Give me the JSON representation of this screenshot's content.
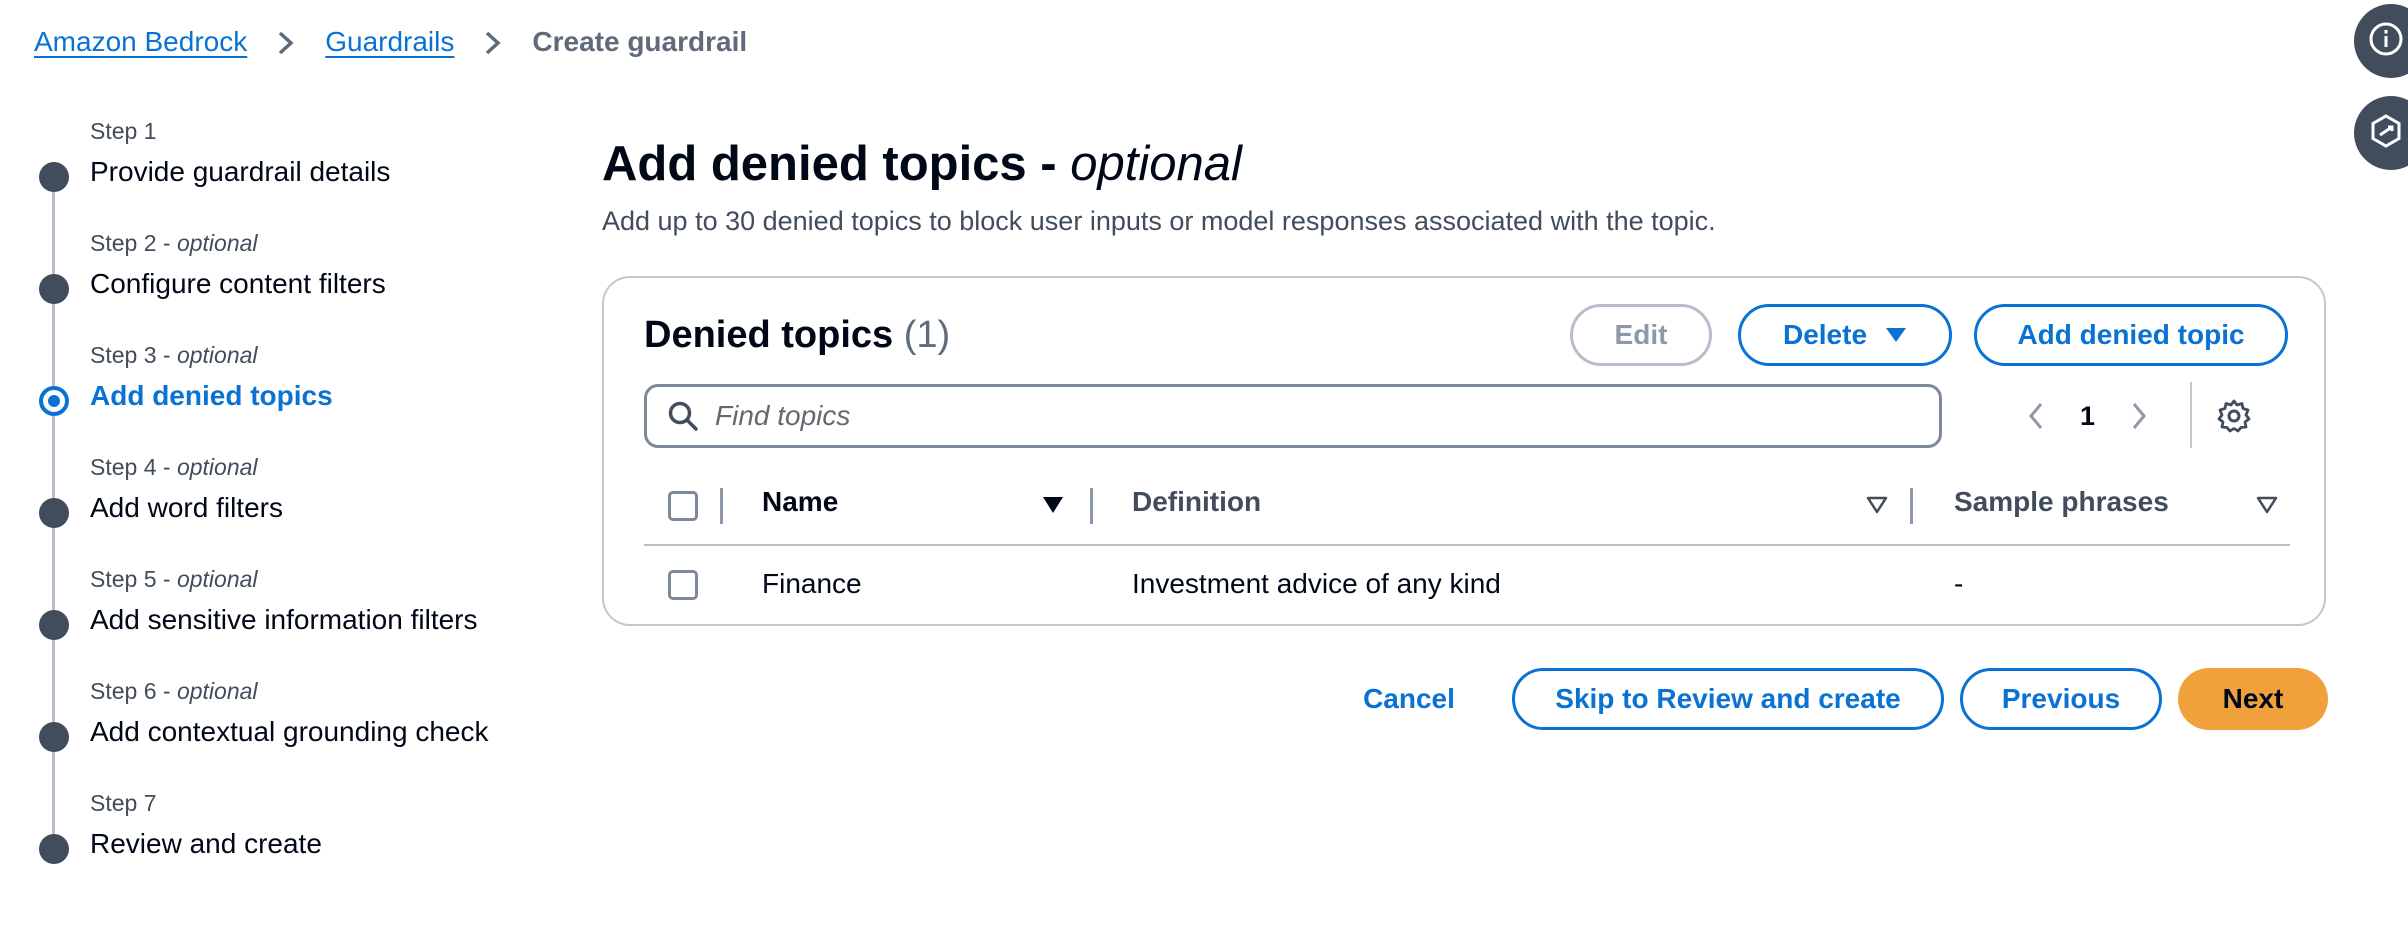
{
  "breadcrumb": {
    "items": [
      "Amazon Bedrock",
      "Guardrails"
    ],
    "current": "Create guardrail"
  },
  "steps": [
    {
      "num": "Step 1",
      "optional": "",
      "title": "Provide guardrail details",
      "active": false
    },
    {
      "num": "Step 2",
      "optional": "optional",
      "title": "Configure content filters",
      "active": false
    },
    {
      "num": "Step 3",
      "optional": "optional",
      "title": "Add denied topics",
      "active": true
    },
    {
      "num": "Step 4",
      "optional": "optional",
      "title": "Add word filters",
      "active": false
    },
    {
      "num": "Step 5",
      "optional": "optional",
      "title": "Add sensitive information filters",
      "active": false
    },
    {
      "num": "Step 6",
      "optional": "optional",
      "title": "Add contextual grounding check",
      "active": false
    },
    {
      "num": "Step 7",
      "optional": "",
      "title": "Review and create",
      "active": false
    }
  ],
  "page": {
    "title": "Add denied topics",
    "title_suffix": "optional",
    "description": "Add up to 30 denied topics to block user inputs or model responses associated with the topic."
  },
  "table": {
    "title": "Denied topics",
    "count": "(1)",
    "edit_label": "Edit",
    "delete_label": "Delete",
    "add_label": "Add denied topic",
    "search_placeholder": "Find topics",
    "page_number": "1",
    "columns": [
      "Name",
      "Definition",
      "Sample phrases"
    ],
    "rows": [
      {
        "name": "Finance",
        "definition": "Investment advice of any kind",
        "samples": "-"
      }
    ]
  },
  "footer": {
    "cancel_label": "Cancel",
    "skip_label": "Skip to Review and create",
    "previous_label": "Previous",
    "next_label": "Next"
  },
  "colors": {
    "link": "#0972d3",
    "primary": "#f1a13c",
    "step_dot": "#414d5c"
  },
  "icons": [
    "chevron-right-icon",
    "info-icon",
    "extension-icon",
    "search-icon",
    "caret-down-icon",
    "sort-icon",
    "angle-left-icon",
    "angle-right-icon",
    "settings-icon"
  ]
}
